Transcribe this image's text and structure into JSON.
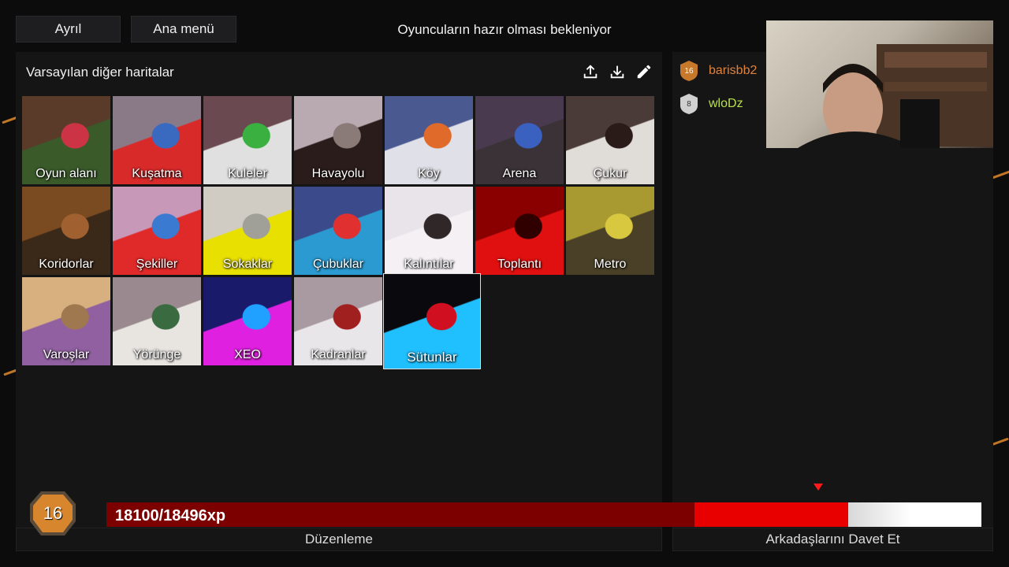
{
  "top": {
    "leave_label": "Ayrıl",
    "menu_label": "Ana menü",
    "status": "Oyuncuların hazır olması bekleniyor"
  },
  "maps_panel": {
    "title": "Varsayılan diğer haritalar",
    "tools": [
      "upload-icon",
      "download-icon",
      "edit-icon"
    ],
    "maps": [
      {
        "label": "Oyun alanı",
        "colors": [
          "#5a3b2a",
          "#3a5a2a",
          "#cc3344"
        ]
      },
      {
        "label": "Kuşatma",
        "colors": [
          "#8a7a88",
          "#d92a2a",
          "#3a6ac0"
        ]
      },
      {
        "label": "Kuleler",
        "colors": [
          "#6a4a50",
          "#e0e0e0",
          "#3ab040"
        ]
      },
      {
        "label": "Havayolu",
        "colors": [
          "#b8aab0",
          "#2a1c1a",
          "#8a7a78"
        ]
      },
      {
        "label": "Köy",
        "colors": [
          "#4a5a90",
          "#e0e0e8",
          "#e06a2a"
        ]
      },
      {
        "label": "Arena",
        "colors": [
          "#4a3a50",
          "#3a3236",
          "#3a60c0"
        ]
      },
      {
        "label": "Çukur",
        "colors": [
          "#4a3a38",
          "#e0dcd8",
          "#2a1a18"
        ]
      },
      {
        "label": "Koridorlar",
        "colors": [
          "#7a4a20",
          "#3a2818",
          "#a06030"
        ]
      },
      {
        "label": "Şekiller",
        "colors": [
          "#c898b8",
          "#e02a2a",
          "#3a7ad0"
        ]
      },
      {
        "label": "Sokaklar",
        "colors": [
          "#d0ccc4",
          "#e8e000",
          "#a0a098"
        ]
      },
      {
        "label": "Çubuklar",
        "colors": [
          "#3a4a8a",
          "#2a9ad0",
          "#e03030"
        ]
      },
      {
        "label": "Kalıntılar",
        "colors": [
          "#e8e4ea",
          "#f4f0f4",
          "#302828"
        ]
      },
      {
        "label": "Toplantı",
        "colors": [
          "#8a0000",
          "#e01010",
          "#300000"
        ]
      },
      {
        "label": "Metro",
        "colors": [
          "#a89a30",
          "#4a4028",
          "#d8c840"
        ]
      },
      {
        "label": "Varoşlar",
        "colors": [
          "#d8b080",
          "#9060a0",
          "#a07850"
        ]
      },
      {
        "label": "Yörünge",
        "colors": [
          "#9a8a90",
          "#e8e4e0",
          "#3a6a40"
        ]
      },
      {
        "label": "XEO",
        "colors": [
          "#1a1a6a",
          "#e020e0",
          "#20a0ff"
        ]
      },
      {
        "label": "Kadranlar",
        "colors": [
          "#a89aa0",
          "#e8e6e8",
          "#a02020"
        ]
      },
      {
        "label": "Sütunlar",
        "colors": [
          "#0a0a0e",
          "#20c0ff",
          "#d01020"
        ]
      }
    ],
    "selected_index": 18
  },
  "players": [
    {
      "name": "barisbb2",
      "level": "16",
      "color": "#e0823a",
      "badge_color": "#c8782a"
    },
    {
      "name": "wloDz",
      "level": "8",
      "color": "#b8e04a",
      "badge_color": "#d0d0d0"
    }
  ],
  "xp": {
    "level": "16",
    "text": "18100/18496xp",
    "current": 18100,
    "max": 18496,
    "dark_fraction": 0.672,
    "bright_fraction": 0.848
  },
  "bottom": {
    "edit_label": "Düzenleme",
    "invite_label": "Arkadaşlarını Davet Et"
  }
}
